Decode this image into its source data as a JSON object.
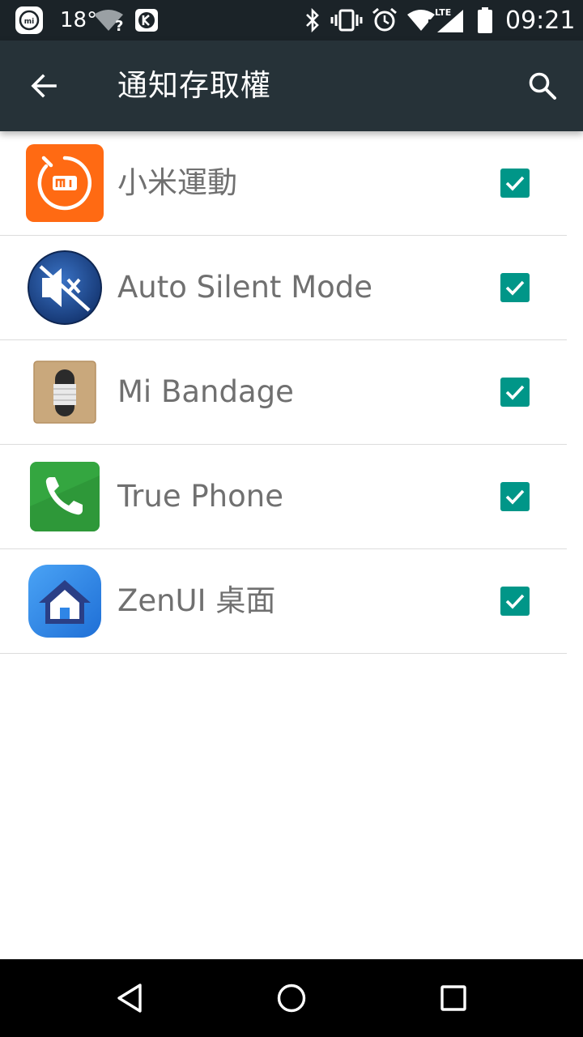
{
  "status_bar": {
    "temperature": "18°",
    "time": "09:21",
    "network_label": "LTE",
    "wifi_unknown": "?",
    "icons": [
      "mi-fit-icon",
      "weather-temp",
      "wifi-question-icon",
      "k-app-icon",
      "bluetooth-icon",
      "vibrate-icon",
      "alarm-icon",
      "wifi-icon",
      "lte-signal-icon",
      "battery-icon"
    ]
  },
  "toolbar": {
    "title": "通知存取權",
    "back_icon": "arrow-back-icon",
    "search_icon": "search-icon"
  },
  "apps": [
    {
      "name": "小米運動",
      "checked": true,
      "icon": "mi-fit-icon",
      "color": "#ff6a13"
    },
    {
      "name": "Auto Silent Mode",
      "checked": true,
      "icon": "muted-speaker-icon",
      "color": "#1e4fa0"
    },
    {
      "name": "Mi Bandage",
      "checked": true,
      "icon": "mi-band-icon",
      "color": "#c9a87c"
    },
    {
      "name": "True Phone",
      "checked": true,
      "icon": "phone-icon",
      "color": "#34a640"
    },
    {
      "name": "ZenUI 桌面",
      "checked": true,
      "icon": "zenui-home-icon",
      "color": "#2f86e6"
    }
  ],
  "colors": {
    "status_bar_bg": "#1b2328",
    "toolbar_bg": "#263238",
    "checkbox": "#009688",
    "label_text": "#707070"
  },
  "nav_bar": {
    "icons": [
      "back-triangle-icon",
      "home-circle-icon",
      "recents-square-icon"
    ]
  }
}
